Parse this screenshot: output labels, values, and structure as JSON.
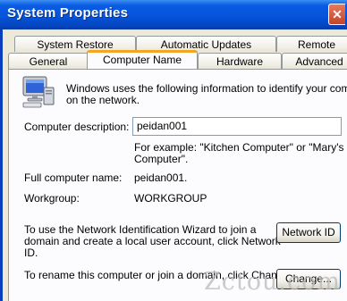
{
  "window": {
    "title": "System Properties",
    "close_glyph": "✕"
  },
  "tabs_row1": [
    {
      "label": "System Restore"
    },
    {
      "label": "Automatic Updates"
    },
    {
      "label": "Remote"
    }
  ],
  "tabs_row2": [
    {
      "label": "General"
    },
    {
      "label": "Computer Name",
      "active": true
    },
    {
      "label": "Hardware"
    },
    {
      "label": "Advanced"
    }
  ],
  "computer_name": {
    "intro_line1": "Windows uses the following information to identify your computer",
    "intro_line2": "on the network.",
    "description_label": "Computer description:",
    "description_value": "peidan001",
    "example_line1": "For example: \"Kitchen Computer\" or \"Mary's",
    "example_line2": "Computer\".",
    "full_name_label": "Full computer name:",
    "full_name_value": "peidan001.",
    "workgroup_label": "Workgroup:",
    "workgroup_value": "WORKGROUP",
    "wizard_line1": "To use the Network Identification Wizard to join a",
    "wizard_line2": "domain and create a local user account, click Network",
    "wizard_line3": "ID.",
    "network_id_button": "Network ID",
    "rename_text": "To rename this computer or join a domain, click Change.",
    "change_button": "Change..."
  },
  "icons": {
    "computer": "computer-monitor-icon"
  },
  "watermark": "Zctou.com",
  "colors": {
    "titlebar": "#0554da",
    "active_tab_accent": "#f4a622",
    "dialog_bg": "#ece9d8",
    "panel_bg": "#fcfcfe",
    "button_border": "#003c74"
  }
}
